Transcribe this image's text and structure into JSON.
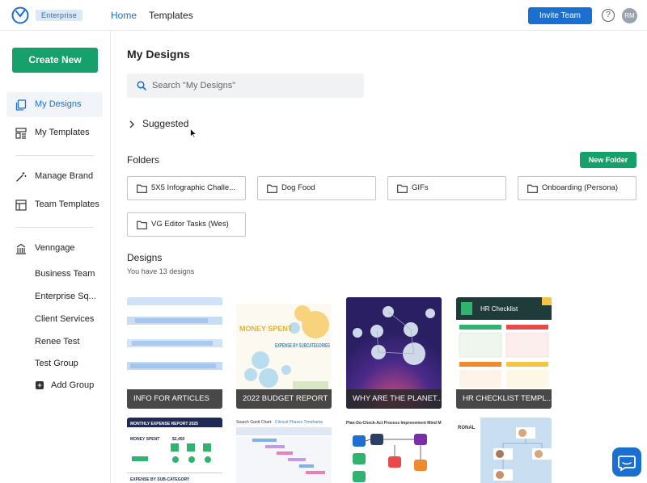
{
  "topbar": {
    "badge": "Enterprise",
    "nav_home": "Home",
    "nav_templates": "Templates",
    "invite_label": "Invite Team",
    "help_glyph": "?",
    "avatar_initials": "RM",
    "accent_color": "#1a6fd0"
  },
  "sidebar": {
    "create_label": "Create New",
    "items": [
      {
        "label": "My Designs",
        "icon": "designs-icon",
        "active": true
      },
      {
        "label": "My Templates",
        "icon": "templates-icon"
      },
      {
        "label": "Manage Brand",
        "icon": "brand-wand-icon"
      },
      {
        "label": "Team Templates",
        "icon": "team-templates-icon"
      },
      {
        "label": "Venngage",
        "icon": "building-icon"
      }
    ],
    "groups": [
      "Business Team",
      "Enterprise Sq...",
      "Client Services",
      "Renee Test",
      "Test Group"
    ],
    "add_group_label": "Add Group",
    "brand_green": "#16a06b"
  },
  "main": {
    "title": "My Designs",
    "search_placeholder": "Search \"My Designs\"",
    "suggested_label": "Suggested",
    "folders_label": "Folders",
    "new_folder_label": "New Folder",
    "folders": [
      "5X5 Infographic Challe...",
      "Dog Food",
      "GIFs",
      "Onboarding (Persona)",
      "VG Editor Tasks (Wes)"
    ],
    "designs_label": "Designs",
    "designs_count_text": "You have 13 designs",
    "designs": [
      {
        "title": "INFO FOR ARTICLES"
      },
      {
        "title": "2022 BUDGET REPORT",
        "thumb_texts": [
          "MONEY SPENT",
          "EXPENSE BY SUBCATEGORIES"
        ]
      },
      {
        "title": "WHY ARE THE PLANET..."
      },
      {
        "title": "HR CHECKLIST TEMPL...",
        "thumb_texts": [
          "HR Checklist"
        ]
      }
    ],
    "designs_row2": [
      {
        "thumb_texts": [
          "MONTHLY EXPENSE REPORT 2025",
          "MONEY SPENT",
          "$2,450",
          "EXPENSE BY SUB-CATEGORY"
        ]
      },
      {
        "thumb_texts": [
          "Search Gantt Chart:",
          "Clinical Phases Timeframe"
        ]
      },
      {
        "thumb_texts": [
          "Plan-Do-Check-Act Process Improvement Mind M"
        ]
      },
      {
        "thumb_texts": [
          "RONAL"
        ]
      }
    ]
  }
}
